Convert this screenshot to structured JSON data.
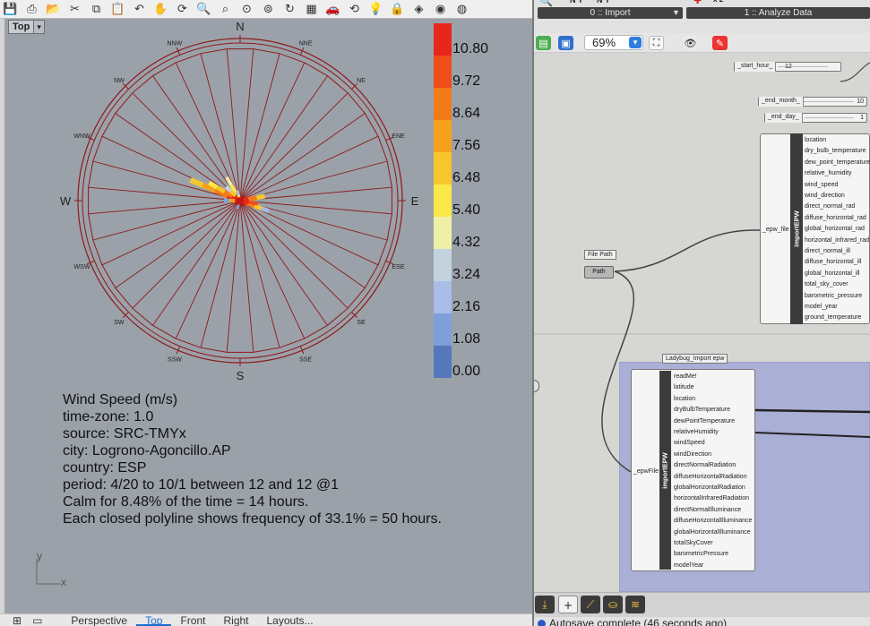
{
  "rhino": {
    "toolbar_icons": [
      "save-icon",
      "print-icon",
      "open-icon",
      "cut-icon",
      "copy-icon",
      "paste-icon",
      "undo-icon",
      "pan-icon",
      "rotate-icon",
      "zoom-icon",
      "zoom-window-icon",
      "zoom-extents-icon",
      "zoom-selected-icon",
      "rotate-view-icon",
      "grid-icon",
      "car-icon",
      "circle-arrow-icon",
      "lightbulb-icon",
      "lock-icon",
      "layers-icon",
      "color-wheel-icon",
      "material-icon"
    ],
    "viewport_label": "Top",
    "viewport_tabs": [
      "Perspective",
      "Top",
      "Front",
      "Right",
      "Layouts..."
    ],
    "active_tab": "Top",
    "axis_y": "y",
    "axis_x": "x"
  },
  "wind_rose": {
    "directions": [
      "N",
      "NNE",
      "NE",
      "ENE",
      "E",
      "ESE",
      "SE",
      "SSE",
      "S",
      "SSW",
      "SW",
      "WSW",
      "W",
      "WNW",
      "NW",
      "NNW"
    ],
    "legend_values": [
      "10.80",
      "9.72",
      "8.64",
      "7.56",
      "6.48",
      "5.40",
      "4.32",
      "3.24",
      "2.16",
      "1.08",
      "0.00"
    ],
    "legend_colors": [
      "#e8271c",
      "#f04d1a",
      "#f37a18",
      "#f5a11d",
      "#f7c62c",
      "#fbe84a",
      "#eff0a8",
      "#c3d3de",
      "#a8bee8",
      "#7f9fd8",
      "#5578bb"
    ],
    "info_lines": [
      "Wind Speed (m/s)",
      "time-zone: 1.0",
      "source: SRC-TMYx",
      "city: Logrono-Agoncillo.AP",
      "country: ESP",
      "period: 4/20 to 10/1 between 12 and 12 @1",
      "Calm for 8.48% of the time = 14 hours.",
      "Each closed polyline shows frequency of 33.1% = 50 hours."
    ]
  },
  "grasshopper": {
    "tab0": "0 :: Import",
    "tab1": "1 :: Analyze Data",
    "zoom": "69%",
    "sliders": [
      {
        "label": "_start_hour_",
        "value": "12"
      },
      {
        "label": "_end_month_",
        "value": "10"
      },
      {
        "label": "_end_day_",
        "value": "1"
      }
    ],
    "import_component": {
      "name": "importEPW",
      "input": "_epw_file",
      "outputs": [
        "location",
        "dry_bulb_temperature",
        "dew_point_temperature",
        "relative_humidity",
        "wind_speed",
        "wind_direction",
        "direct_normal_rad",
        "diffuse_horizontal_rad",
        "global_horizontal_rad",
        "horizontal_infrared_rad",
        "direct_normal_ill",
        "diffuse_horizontal_ill",
        "global_horizontal_ill",
        "total_sky_cover",
        "barometric_pressure",
        "model_year",
        "ground_temperature"
      ]
    },
    "file_path_tag": "File Path",
    "path_component": "Path",
    "ladybug_group_label": "Ladybug_Import epw",
    "ladybug_component": {
      "name": "importEPW",
      "input": "_epwFile",
      "outputs": [
        "readMe!",
        "latitude",
        "location",
        "dryBulbTemperature",
        "dewPointTemperature",
        "relativeHumidity",
        "windSpeed",
        "windDirection",
        "directNormalRadiation",
        "diffuseHorizontalRadiation",
        "globalHorizontalRadiation",
        "horizontalInfraredRadiation",
        "directNormalIlluminance",
        "diffuseHorizontalIlluminance",
        "globalHorizontalIlluminance",
        "totalSkyCover",
        "barometricPressure",
        "modelYear"
      ]
    },
    "status": "Autosave complete (46 seconds ago)"
  }
}
